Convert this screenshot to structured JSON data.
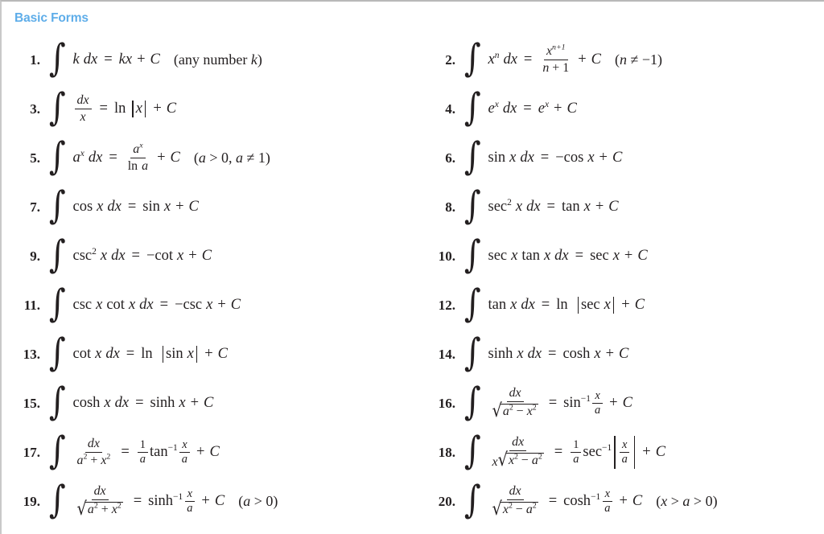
{
  "section": {
    "title": "Basic Forms",
    "title_color": "#5eade9"
  },
  "formulas": [
    {
      "n": "1.",
      "latex": "\\int k\\,dx = kx + C",
      "condition": "(any number k)"
    },
    {
      "n": "2.",
      "latex": "\\int x^n\\,dx = \\frac{x^{n+1}}{n+1} + C",
      "condition": "(n ≠ −1)"
    },
    {
      "n": "3.",
      "latex": "\\int \\frac{dx}{x} = \\ln|x| + C",
      "condition": ""
    },
    {
      "n": "4.",
      "latex": "\\int e^x\\,dx = e^x + C",
      "condition": ""
    },
    {
      "n": "5.",
      "latex": "\\int a^x\\,dx = \\frac{a^x}{\\ln a} + C",
      "condition": "(a > 0, a ≠ 1)"
    },
    {
      "n": "6.",
      "latex": "\\int \\sin x\\,dx = -\\cos x + C",
      "condition": ""
    },
    {
      "n": "7.",
      "latex": "\\int \\cos x\\,dx = \\sin x + C",
      "condition": ""
    },
    {
      "n": "8.",
      "latex": "\\int \\sec^2 x\\,dx = \\tan x + C",
      "condition": ""
    },
    {
      "n": "9.",
      "latex": "\\int \\csc^2 x\\,dx = -\\cot x + C",
      "condition": ""
    },
    {
      "n": "10.",
      "latex": "\\int \\sec x \\tan x\\,dx = \\sec x + C",
      "condition": ""
    },
    {
      "n": "11.",
      "latex": "\\int \\csc x \\cot x\\,dx = -\\csc x + C",
      "condition": ""
    },
    {
      "n": "12.",
      "latex": "\\int \\tan x\\,dx = \\ln|\\sec x| + C",
      "condition": ""
    },
    {
      "n": "13.",
      "latex": "\\int \\cot x\\,dx = \\ln|\\sin x| + C",
      "condition": ""
    },
    {
      "n": "14.",
      "latex": "\\int \\sinh x\\,dx = \\cosh x + C",
      "condition": ""
    },
    {
      "n": "15.",
      "latex": "\\int \\cosh x\\,dx = \\sinh x + C",
      "condition": ""
    },
    {
      "n": "16.",
      "latex": "\\int \\frac{dx}{\\sqrt{a^2-x^2}} = \\sin^{-1}\\frac{x}{a} + C",
      "condition": ""
    },
    {
      "n": "17.",
      "latex": "\\int \\frac{dx}{a^2+x^2} = \\frac{1}{a}\\tan^{-1}\\frac{x}{a} + C",
      "condition": ""
    },
    {
      "n": "18.",
      "latex": "\\int \\frac{dx}{x\\sqrt{x^2-a^2}} = \\frac{1}{a}\\sec^{-1}\\left|\\frac{x}{a}\\right| + C",
      "condition": ""
    },
    {
      "n": "19.",
      "latex": "\\int \\frac{dx}{\\sqrt{a^2+x^2}} = \\sinh^{-1}\\frac{x}{a} + C",
      "condition": "(a > 0)"
    },
    {
      "n": "20.",
      "latex": "\\int \\frac{dx}{\\sqrt{x^2-a^2}} = \\cosh^{-1}\\frac{x}{a} + C",
      "condition": "(x > a > 0)"
    }
  ],
  "symbols": {
    "integral": "∫",
    "radical": "√",
    "not_equal": "≠",
    "minus": "−",
    "greater_than": ">"
  }
}
